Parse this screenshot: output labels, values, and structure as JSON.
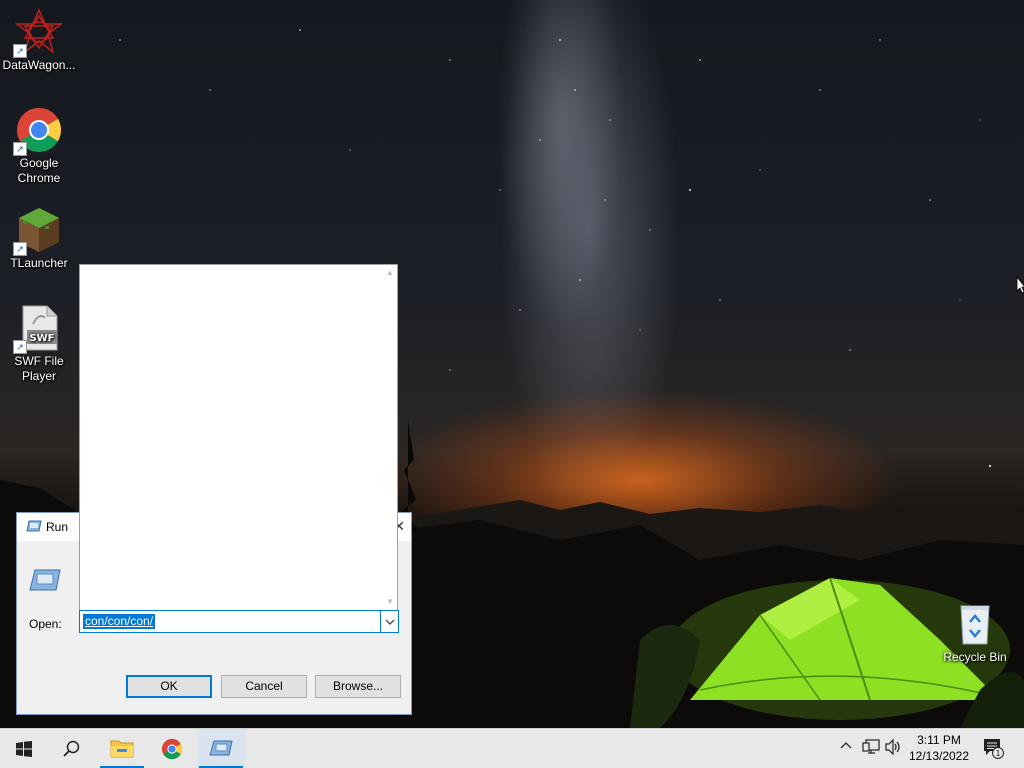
{
  "desktop": {
    "icons": [
      {
        "label_line1": "DataWagon...",
        "label_line2": "",
        "icon": "datawagon-icon"
      },
      {
        "label_line1": "Google",
        "label_line2": "Chrome",
        "icon": "chrome-icon"
      },
      {
        "label_line1": "TLauncher",
        "label_line2": "",
        "icon": "tlauncher-icon"
      },
      {
        "label_line1": "SWF File",
        "label_line2": "Player",
        "icon": "swf-player-icon"
      }
    ],
    "recycle_bin": {
      "label": "Recycle Bin",
      "icon": "recycle-bin-icon"
    },
    "swf_text": "SWF"
  },
  "run_dialog": {
    "title": "Run",
    "close_glyph": "✕",
    "open_label": "Open:",
    "open_value": "con/con/con/",
    "buttons": {
      "ok": "OK",
      "cancel": "Cancel",
      "browse": "Browse..."
    },
    "accent_color": "#0078d7"
  },
  "taskbar": {
    "start_icon": "windows-start-icon",
    "search_icon": "search-icon",
    "pinned": [
      "file-explorer-icon",
      "chrome-icon",
      "run-icon"
    ],
    "tray": {
      "chevron": "^",
      "clock_time": "3:11 PM",
      "clock_date": "12/13/2022",
      "notification_count": "1"
    }
  }
}
